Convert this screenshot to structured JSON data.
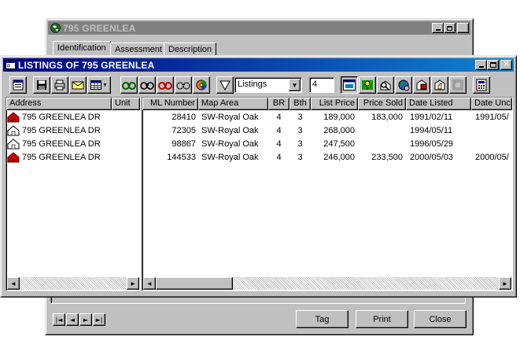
{
  "back_window": {
    "title": "795 GREENLEA",
    "tabs": [
      "Identification",
      "Assessment",
      "Description"
    ],
    "buttons": {
      "tag": "Tag",
      "print": "Print",
      "close": "Close"
    },
    "nav_glyphs": [
      "|◄",
      "◄",
      "►",
      "►|"
    ]
  },
  "listings_window": {
    "title": "LISTINGS OF 795 GREENLEA",
    "toolbar": {
      "filter_select_value": "Listings",
      "count_value": "4"
    },
    "left_columns": [
      "Address",
      "Unit"
    ],
    "right_columns": [
      "ML Number",
      "Map Area",
      "BR",
      "Bth",
      "List Price",
      "Price Sold",
      "Date Listed",
      "Date Unc"
    ],
    "rows": [
      {
        "icon": "sold-house-icon",
        "address": "795 GREENLEA DR",
        "unit": "",
        "ml_number": "28410",
        "map_area": "SW-Royal Oak",
        "br": "4",
        "bth": "3",
        "list_price": "189,000",
        "price_sold": "183,000",
        "date_listed": "1991/02/11",
        "date_unc": "1991/05/"
      },
      {
        "icon": "house-icon",
        "address": "795 GREENLEA DR",
        "unit": "",
        "ml_number": "72305",
        "map_area": "SW-Royal Oak",
        "br": "4",
        "bth": "3",
        "list_price": "268,000",
        "price_sold": "",
        "date_listed": "1994/05/11",
        "date_unc": ""
      },
      {
        "icon": "house-icon",
        "address": "795 GREENLEA DR",
        "unit": "",
        "ml_number": "98867",
        "map_area": "SW-Royal Oak",
        "br": "4",
        "bth": "3",
        "list_price": "247,500",
        "price_sold": "",
        "date_listed": "1996/05/29",
        "date_unc": ""
      },
      {
        "icon": "sold-house-icon",
        "address": "795 GREENLEA DR",
        "unit": "",
        "ml_number": "144533",
        "map_area": "SW-Royal Oak",
        "br": "4",
        "bth": "3",
        "list_price": "246,000",
        "price_sold": "233,500",
        "date_listed": "2000/05/03",
        "date_unc": "2000/05/"
      }
    ]
  },
  "colors": {
    "title_active_start": "#000080",
    "title_active_end": "#1084d0",
    "title_inactive": "#808080",
    "face": "#c0c0c0",
    "sold_icon": "#cc0000"
  }
}
